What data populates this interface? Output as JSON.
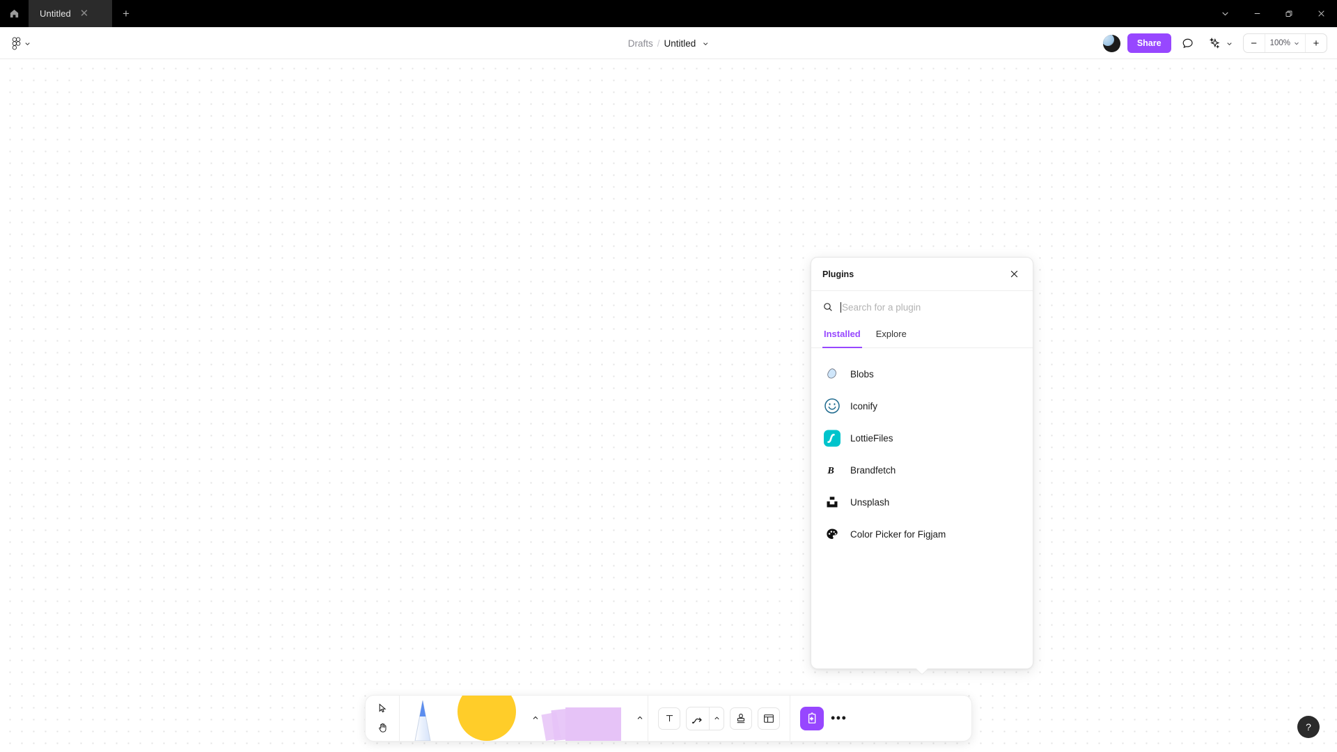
{
  "window": {
    "home_icon": "home-icon",
    "tab": {
      "label": "Untitled",
      "close_icon": "close-icon"
    },
    "new_tab_label": "+",
    "controls": {
      "menu_chevron": "chevron-down-icon",
      "minimize": "minimize-icon",
      "maximize": "restore-icon",
      "close": "close-icon"
    }
  },
  "toolbar": {
    "main_menu_icon": "figma-logo-icon",
    "main_menu_chevron": "chevron-down-icon",
    "breadcrumb": {
      "parent": "Drafts",
      "separator": "/",
      "title": "Untitled",
      "chevron": "chevron-down-icon"
    },
    "avatar_name": "user-avatar",
    "share_label": "Share",
    "comment_icon": "comment-icon",
    "ai_icon": "sparkle-icon",
    "ai_chevron": "chevron-down-icon",
    "zoom": {
      "minus": "−",
      "value": "100%",
      "chevron": "chevron-down-icon",
      "plus": "+"
    }
  },
  "plugins_panel": {
    "title": "Plugins",
    "close_icon": "close-icon",
    "search": {
      "icon": "search-icon",
      "value": "",
      "placeholder": "Search for a plugin"
    },
    "tabs": [
      {
        "label": "Installed",
        "active": true
      },
      {
        "label": "Explore",
        "active": false
      }
    ],
    "accent_color": "#9747ff",
    "items": [
      {
        "name": "Blobs",
        "icon": "blob-icon"
      },
      {
        "name": "Iconify",
        "icon": "smiley-face-icon"
      },
      {
        "name": "LottieFiles",
        "icon": "lottiefiles-icon"
      },
      {
        "name": "Brandfetch",
        "icon": "brandfetch-b-icon"
      },
      {
        "name": "Unsplash",
        "icon": "unsplash-icon"
      },
      {
        "name": "Color Picker for Figjam",
        "icon": "palette-icon"
      }
    ]
  },
  "bottom_toolbar": {
    "cursor_tools": [
      {
        "name": "select-tool",
        "icon": "cursor-arrow-icon"
      },
      {
        "name": "hand-tool",
        "icon": "hand-icon"
      }
    ],
    "pen_tool": {
      "label": "pen-tool",
      "color": "#5b8def"
    },
    "shape_tool": {
      "label": "shape-tool",
      "color": "#ffcd29",
      "chevron": "chevron-up-icon"
    },
    "sticky_tool": {
      "label": "sticky-note-tool",
      "color": "#e6c3f7",
      "chevron": "chevron-up-icon"
    },
    "text_tool": {
      "label": "text-tool",
      "icon": "text-T-icon"
    },
    "connector_tool": {
      "label": "connector-tool",
      "icon": "connector-arrow-icon",
      "chevron": "chevron-up-icon"
    },
    "stamp_tool": {
      "label": "stamp-tool",
      "icon": "stamp-icon"
    },
    "section_tool": {
      "label": "section-tool",
      "icon": "section-icon"
    },
    "plugin_button": {
      "label": "plugins-tool",
      "icon": "puzzle-icon",
      "color": "#9747ff",
      "active": true
    },
    "more_label": "•••"
  },
  "help": {
    "label": "?",
    "name": "help-button"
  }
}
